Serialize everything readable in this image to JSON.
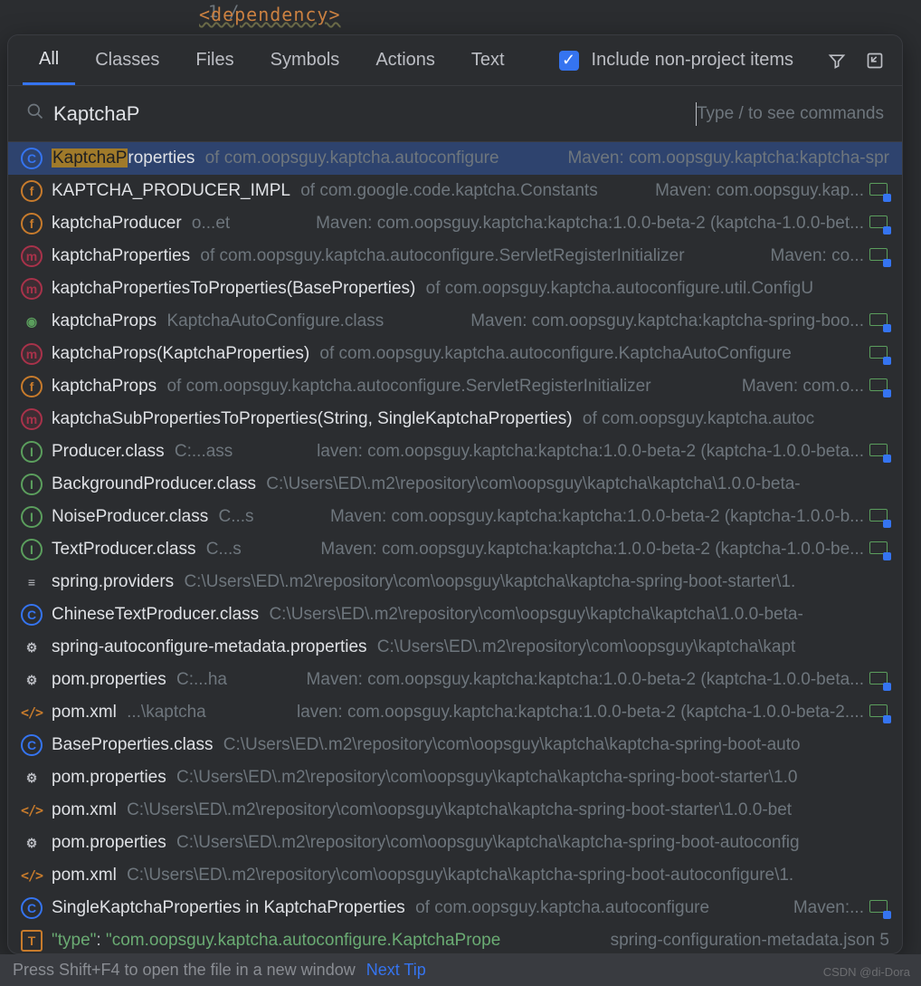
{
  "background": {
    "gutter": "1 /",
    "tag": "<dependency>"
  },
  "tabs": [
    "All",
    "Classes",
    "Files",
    "Symbols",
    "Actions",
    "Text"
  ],
  "active_tab": 0,
  "include_nonproject_label": "Include non-project items",
  "search": {
    "query": "KaptchaP",
    "placeholder": "Type / to see commands"
  },
  "results": [
    {
      "icon": "class",
      "primary": "KaptchaProperties",
      "highlight": "KaptchaP",
      "secondary": "of com.oopsguy.kaptcha.autoconfigure",
      "right": "Maven: com.oopsguy.kaptcha:kaptcha-spr",
      "selected": true
    },
    {
      "icon": "field",
      "primary": "KAPTCHA_PRODUCER_IMPL",
      "secondary": "of com.google.code.kaptcha.Constants",
      "right": "Maven: com.oopsguy.kap...",
      "suffix": true
    },
    {
      "icon": "field",
      "primary": "kaptchaProducer",
      "secondary": "o...et",
      "right": "Maven: com.oopsguy.kaptcha:kaptcha:1.0.0-beta-2 (kaptcha-1.0.0-bet...",
      "suffix": true
    },
    {
      "icon": "method",
      "primary": "kaptchaProperties",
      "secondary": "of com.oopsguy.kaptcha.autoconfigure.ServletRegisterInitializer",
      "right": "Maven: co...",
      "suffix": true
    },
    {
      "icon": "method",
      "primary": "kaptchaPropertiesToProperties(BaseProperties)",
      "secondary": "of com.oopsguy.kaptcha.autoconfigure.util.ConfigU"
    },
    {
      "icon": "bean",
      "primary": "kaptchaProps",
      "secondary": "KaptchaAutoConfigure.class",
      "right": "Maven: com.oopsguy.kaptcha:kaptcha-spring-boo...",
      "suffix": true
    },
    {
      "icon": "method",
      "primary": "kaptchaProps(KaptchaProperties)",
      "secondary": "of com.oopsguy.kaptcha.autoconfigure.KaptchaAutoConfigure",
      "suffix": true
    },
    {
      "icon": "field",
      "primary": "kaptchaProps",
      "secondary": "of com.oopsguy.kaptcha.autoconfigure.ServletRegisterInitializer",
      "right": "Maven: com.o...",
      "suffix": true
    },
    {
      "icon": "method",
      "primary": "kaptchaSubPropertiesToProperties(String, SingleKaptchaProperties)",
      "secondary": "of com.oopsguy.kaptcha.autoc"
    },
    {
      "icon": "interface",
      "primary": "Producer.class",
      "secondary": "C:...ass",
      "right": "laven: com.oopsguy.kaptcha:kaptcha:1.0.0-beta-2 (kaptcha-1.0.0-beta...",
      "suffix": true
    },
    {
      "icon": "interface",
      "primary": "BackgroundProducer.class",
      "secondary": "C:\\Users\\ED\\.m2\\repository\\com\\oopsguy\\kaptcha\\kaptcha\\1.0.0-beta-"
    },
    {
      "icon": "interface",
      "primary": "NoiseProducer.class",
      "secondary": "C...s",
      "right": "Maven: com.oopsguy.kaptcha:kaptcha:1.0.0-beta-2 (kaptcha-1.0.0-b...",
      "suffix": true
    },
    {
      "icon": "interface",
      "primary": "TextProducer.class",
      "secondary": "C...s",
      "right": "Maven: com.oopsguy.kaptcha:kaptcha:1.0.0-beta-2 (kaptcha-1.0.0-be...",
      "suffix": true
    },
    {
      "icon": "list",
      "primary": "spring.providers",
      "secondary": "C:\\Users\\ED\\.m2\\repository\\com\\oopsguy\\kaptcha\\kaptcha-spring-boot-starter\\1."
    },
    {
      "icon": "class",
      "primary": "ChineseTextProducer.class",
      "secondary": "C:\\Users\\ED\\.m2\\repository\\com\\oopsguy\\kaptcha\\kaptcha\\1.0.0-beta-"
    },
    {
      "icon": "gear",
      "primary": "spring-autoconfigure-metadata.properties",
      "secondary": "C:\\Users\\ED\\.m2\\repository\\com\\oopsguy\\kaptcha\\kapt"
    },
    {
      "icon": "gear",
      "primary": "pom.properties",
      "secondary": "C:...ha",
      "right": "Maven: com.oopsguy.kaptcha:kaptcha:1.0.0-beta-2 (kaptcha-1.0.0-beta...",
      "suffix": true
    },
    {
      "icon": "xml",
      "primary": "pom.xml",
      "secondary": "...\\kaptcha",
      "right": "laven: com.oopsguy.kaptcha:kaptcha:1.0.0-beta-2 (kaptcha-1.0.0-beta-2....",
      "suffix": true
    },
    {
      "icon": "class",
      "primary": "BaseProperties.class",
      "secondary": "C:\\Users\\ED\\.m2\\repository\\com\\oopsguy\\kaptcha\\kaptcha-spring-boot-auto"
    },
    {
      "icon": "gear",
      "primary": "pom.properties",
      "secondary": "C:\\Users\\ED\\.m2\\repository\\com\\oopsguy\\kaptcha\\kaptcha-spring-boot-starter\\1.0"
    },
    {
      "icon": "xml",
      "primary": "pom.xml",
      "secondary": "C:\\Users\\ED\\.m2\\repository\\com\\oopsguy\\kaptcha\\kaptcha-spring-boot-starter\\1.0.0-bet"
    },
    {
      "icon": "gear",
      "primary": "pom.properties",
      "secondary": "C:\\Users\\ED\\.m2\\repository\\com\\oopsguy\\kaptcha\\kaptcha-spring-boot-autoconfig"
    },
    {
      "icon": "xml",
      "primary": "pom.xml",
      "secondary": "C:\\Users\\ED\\.m2\\repository\\com\\oopsguy\\kaptcha\\kaptcha-spring-boot-autoconfigure\\1."
    },
    {
      "icon": "class",
      "primary": "SingleKaptchaProperties in KaptchaProperties",
      "secondary": "of com.oopsguy.kaptcha.autoconfigure",
      "right": "Maven:...",
      "suffix": true
    },
    {
      "icon": "t",
      "json_key": "\"type\"",
      "json_str": "\"com.oopsguy.kaptcha.autoconfigure.KaptchaPrope",
      "right": "spring-configuration-metadata.json 5"
    }
  ],
  "footer": {
    "hint": "Press Shift+F4 to open the file in a new window",
    "next_tip": "Next Tip"
  },
  "watermark": "CSDN @di-Dora"
}
